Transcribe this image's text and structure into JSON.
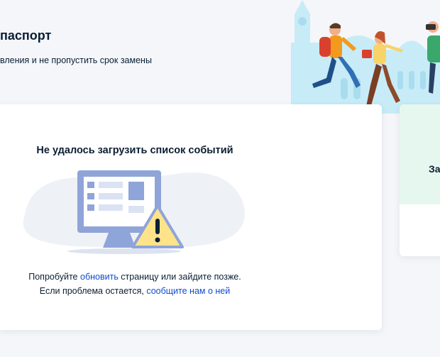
{
  "hero": {
    "title": "паспорт",
    "subtitle": "вления и не пропустить срок замены"
  },
  "error": {
    "title": "Не удалось загрузить список событий",
    "line1_prefix": "Попробуйте ",
    "reload_link": "обновить",
    "line1_suffix": " страницу или зайдите позже.",
    "line2_prefix": "Если проблема остается, ",
    "report_link": "сообщите нам о ней"
  },
  "side_card": {
    "title": "За"
  },
  "colors": {
    "link": "#0d4cd3",
    "page_bg": "#f4f6fa",
    "side_card_accent": "#e6f7ef",
    "warning": "#ffe38a"
  }
}
